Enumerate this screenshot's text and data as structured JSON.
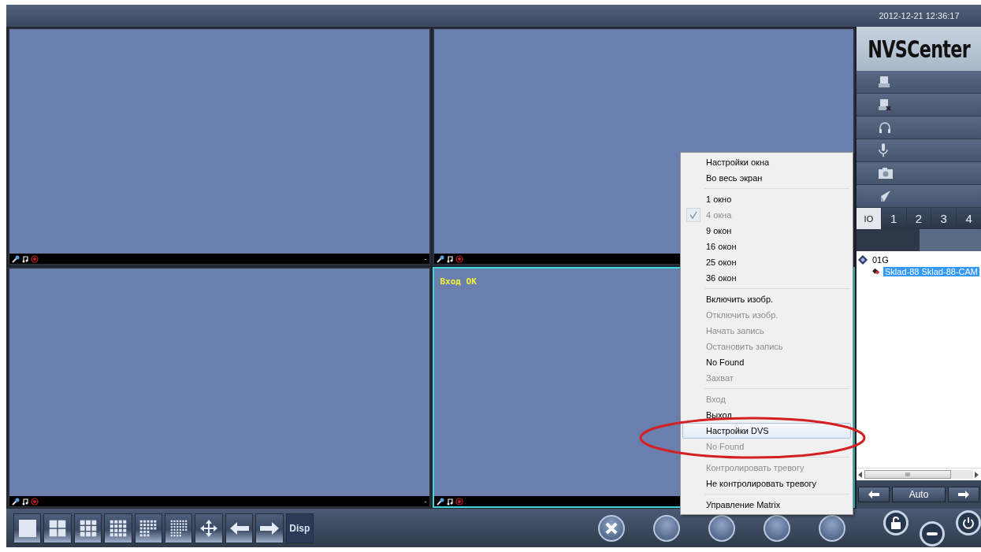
{
  "datetime": "2012-12-21 12:36:17",
  "logo": "NVSCenter",
  "video_cells": [
    {
      "selected": false,
      "status_mark": "-"
    },
    {
      "selected": false
    },
    {
      "selected": false,
      "status_mark": "-"
    },
    {
      "selected": true,
      "message": "Вход OK"
    }
  ],
  "context_menu": {
    "items": [
      {
        "kind": "item",
        "label": "Настройки окна",
        "disabled": false,
        "checked": false,
        "selected": false
      },
      {
        "kind": "item",
        "label": "Во весь экран",
        "disabled": false,
        "checked": false,
        "selected": false
      },
      {
        "kind": "separator"
      },
      {
        "kind": "item",
        "label": "1 окно",
        "disabled": false,
        "checked": false,
        "selected": false
      },
      {
        "kind": "item",
        "label": "4 окна",
        "disabled": true,
        "checked": true,
        "selected": false
      },
      {
        "kind": "item",
        "label": "9 окон",
        "disabled": false,
        "checked": false,
        "selected": false
      },
      {
        "kind": "item",
        "label": "16 окон",
        "disabled": false,
        "checked": false,
        "selected": false
      },
      {
        "kind": "item",
        "label": "25 окон",
        "disabled": false,
        "checked": false,
        "selected": false
      },
      {
        "kind": "item",
        "label": "36 окон",
        "disabled": false,
        "checked": false,
        "selected": false
      },
      {
        "kind": "separator"
      },
      {
        "kind": "item",
        "label": "Включить изобр.",
        "disabled": false,
        "checked": false,
        "selected": false
      },
      {
        "kind": "item",
        "label": "Отключить изобр.",
        "disabled": true,
        "checked": false,
        "selected": false
      },
      {
        "kind": "item",
        "label": "Начать запись",
        "disabled": true,
        "checked": false,
        "selected": false
      },
      {
        "kind": "item",
        "label": "Остановить запись",
        "disabled": true,
        "checked": false,
        "selected": false
      },
      {
        "kind": "item",
        "label": "No Found",
        "disabled": false,
        "checked": false,
        "selected": false
      },
      {
        "kind": "item",
        "label": "Захват",
        "disabled": true,
        "checked": false,
        "selected": false
      },
      {
        "kind": "separator"
      },
      {
        "kind": "item",
        "label": "Вход",
        "disabled": true,
        "checked": false,
        "selected": false
      },
      {
        "kind": "item",
        "label": "Выход",
        "disabled": false,
        "checked": false,
        "selected": false
      },
      {
        "kind": "item",
        "label": "Настройки DVS",
        "disabled": false,
        "checked": false,
        "selected": true
      },
      {
        "kind": "item",
        "label": "No Found",
        "disabled": true,
        "checked": false,
        "selected": false
      },
      {
        "kind": "separator"
      },
      {
        "kind": "item",
        "label": "Контролировать тревогу",
        "disabled": true,
        "checked": false,
        "selected": false
      },
      {
        "kind": "item",
        "label": "Не контролировать тревогу",
        "disabled": false,
        "checked": false,
        "selected": false
      },
      {
        "kind": "separator"
      },
      {
        "kind": "item",
        "label": "Управление Matrix",
        "disabled": false,
        "checked": false,
        "selected": false
      }
    ]
  },
  "side_tabs": [
    {
      "label": "IO",
      "selected": true
    },
    {
      "label": "1",
      "selected": false
    },
    {
      "label": "2",
      "selected": false
    },
    {
      "label": "3",
      "selected": false
    },
    {
      "label": "4",
      "selected": false
    }
  ],
  "device_tree": [
    {
      "label": "01G",
      "selected": false,
      "children": [
        {
          "label": "Sklad-88 Sklad-88-CAM",
          "selected": true
        }
      ]
    }
  ],
  "scrollbar_grip": "III",
  "nav_label": "Auto",
  "disp_label": "Disp"
}
